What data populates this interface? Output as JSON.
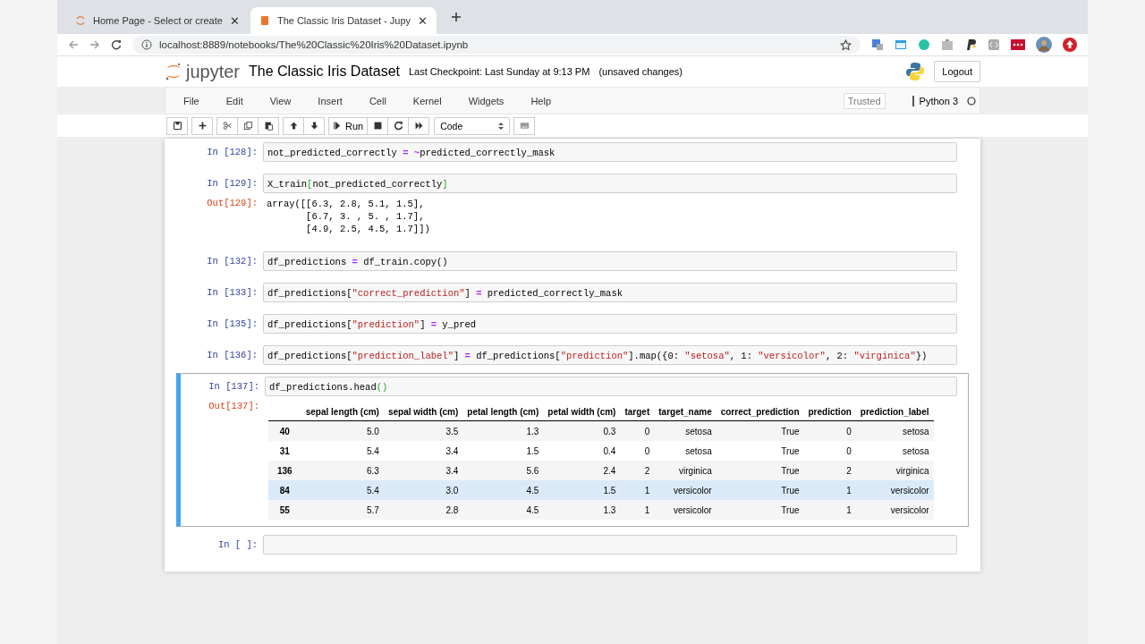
{
  "browser": {
    "tabs": [
      {
        "title": "Home Page - Select or create",
        "close": "✕",
        "selected": false
      },
      {
        "title": "The Classic Iris Dataset - Jupy",
        "close": "✕",
        "selected": true
      }
    ],
    "address": "localhost:8889/notebooks/The%20Classic%20Iris%20Dataset.ipynb"
  },
  "header": {
    "logo": "jupyter",
    "title": "The Classic Iris Dataset",
    "checkpoint": "Last Checkpoint: Last Sunday at 9:13 PM",
    "status": "(unsaved changes)",
    "logout": "Logout"
  },
  "menu": [
    "File",
    "Edit",
    "View",
    "Insert",
    "Cell",
    "Kernel",
    "Widgets",
    "Help"
  ],
  "trusted": "Trusted",
  "kernel": "Python 3",
  "toolbar": {
    "run": "Run",
    "cell_type": "Code"
  },
  "cells": [
    {
      "prompt": "In [128]:",
      "selected": false,
      "code": [
        {
          "t": "not_predicted_correctly "
        },
        {
          "t": "=",
          "kind": "op"
        },
        {
          "t": " ~",
          "kind": "op"
        },
        {
          "t": "predicted_correctly_mask"
        }
      ]
    },
    {
      "prompt": "In [129]:",
      "selected": false,
      "code": [
        {
          "t": "X_train"
        },
        {
          "t": "[",
          "kind": "br"
        },
        {
          "t": "not_predicted_correctly"
        },
        {
          "t": "]",
          "kind": "br"
        }
      ],
      "output": {
        "kind": "text",
        "prompt": "Out[129]:",
        "lines": [
          "array([[6.3, 2.8, 5.1, 1.5],",
          "       [6.7, 3. , 5. , 1.7],",
          "       [4.9, 2.5, 4.5, 1.7]])"
        ]
      }
    },
    {
      "prompt": "In [132]:",
      "selected": false,
      "code": [
        {
          "t": "df_predictions "
        },
        {
          "t": "=",
          "kind": "op"
        },
        {
          "t": " df_train.copy()"
        }
      ]
    },
    {
      "prompt": "In [133]:",
      "selected": false,
      "code": [
        {
          "t": "df_predictions["
        },
        {
          "t": "\"correct_prediction\"",
          "kind": "str"
        },
        {
          "t": "] "
        },
        {
          "t": "=",
          "kind": "op"
        },
        {
          "t": " predicted_correctly_mask"
        }
      ]
    },
    {
      "prompt": "In [135]:",
      "selected": false,
      "code": [
        {
          "t": "df_predictions["
        },
        {
          "t": "\"prediction\"",
          "kind": "str"
        },
        {
          "t": "] "
        },
        {
          "t": "=",
          "kind": "op"
        },
        {
          "t": " y_pred"
        }
      ]
    },
    {
      "prompt": "In [136]:",
      "selected": false,
      "code": [
        {
          "t": "df_predictions["
        },
        {
          "t": "\"prediction_label\"",
          "kind": "str"
        },
        {
          "t": "] "
        },
        {
          "t": "=",
          "kind": "op"
        },
        {
          "t": " df_predictions["
        },
        {
          "t": "\"prediction\"",
          "kind": "str"
        },
        {
          "t": "].map({0: "
        },
        {
          "t": "\"setosa\"",
          "kind": "str"
        },
        {
          "t": ", 1: "
        },
        {
          "t": "\"versicolor\"",
          "kind": "str"
        },
        {
          "t": ", 2: "
        },
        {
          "t": "\"virginica\"",
          "kind": "str"
        },
        {
          "t": "})"
        }
      ]
    },
    {
      "prompt": "In [137]:",
      "selected": true,
      "code": [
        {
          "t": "df_predictions.head"
        },
        {
          "t": "()",
          "kind": "br"
        }
      ],
      "output": {
        "kind": "table",
        "prompt": "Out[137]:",
        "columns": [
          "sepal length (cm)",
          "sepal width (cm)",
          "petal length (cm)",
          "petal width (cm)",
          "target",
          "target_name",
          "correct_prediction",
          "prediction",
          "prediction_label"
        ],
        "rows": [
          {
            "index": "40",
            "cells": [
              "5.0",
              "3.5",
              "1.3",
              "0.3",
              "0",
              "setosa",
              "True",
              "0",
              "setosa"
            ],
            "selected": false
          },
          {
            "index": "31",
            "cells": [
              "5.4",
              "3.4",
              "1.5",
              "0.4",
              "0",
              "setosa",
              "True",
              "0",
              "setosa"
            ],
            "selected": false
          },
          {
            "index": "136",
            "cells": [
              "6.3",
              "3.4",
              "5.6",
              "2.4",
              "2",
              "virginica",
              "True",
              "2",
              "virginica"
            ],
            "selected": false
          },
          {
            "index": "84",
            "cells": [
              "5.4",
              "3.0",
              "4.5",
              "1.5",
              "1",
              "versicolor",
              "True",
              "1",
              "versicolor"
            ],
            "selected": true
          },
          {
            "index": "55",
            "cells": [
              "5.7",
              "2.8",
              "4.5",
              "1.3",
              "1",
              "versicolor",
              "True",
              "1",
              "versicolor"
            ],
            "selected": false
          }
        ]
      }
    },
    {
      "prompt": "In [ ]:",
      "selected": false
    }
  ]
}
